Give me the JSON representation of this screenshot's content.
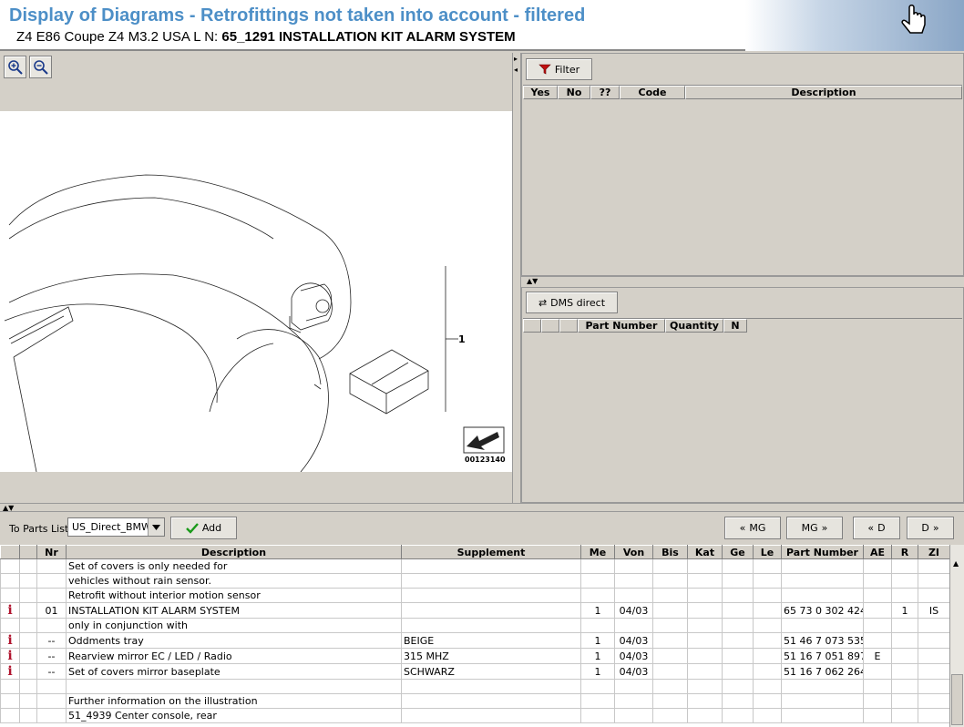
{
  "header": {
    "title": "Display of Diagrams - Retrofittings not taken into account - filtered",
    "vehicle": "Z4 E86 Coupe Z4 M3.2 USA  L N:",
    "group": "65_1291 INSTALLATION KIT ALARM SYSTEM"
  },
  "diagram": {
    "callout": "1",
    "image_number": "00123140"
  },
  "filter_panel": {
    "filter_label": "Filter",
    "columns": [
      "Yes",
      "No",
      "??",
      "Code",
      "Description"
    ]
  },
  "dms_panel": {
    "dms_label": "DMS direct",
    "columns": [
      "",
      "",
      "",
      "Part Number",
      "Quantity",
      "N"
    ]
  },
  "parts_bar": {
    "to_parts_label": "To Parts List",
    "list_value": "US_Direct_BMW",
    "add_label": "Add",
    "prev_mg": "MG",
    "next_mg": "MG",
    "prev_d": "D",
    "next_d": "D"
  },
  "parts_table": {
    "columns": [
      "",
      "",
      "Nr",
      "Description",
      "Supplement",
      "Me",
      "Von",
      "Bis",
      "Kat",
      "Ge",
      "Le",
      "Part Number",
      "AE",
      "R",
      "ZI"
    ],
    "rows": [
      {
        "info": "",
        "nr": "",
        "desc": "Set of covers is only needed for",
        "sup": "",
        "me": "",
        "von": "",
        "pn": "",
        "ae": "",
        "r": "",
        "zi": ""
      },
      {
        "info": "",
        "nr": "",
        "desc": "vehicles without rain sensor.",
        "sup": "",
        "me": "",
        "von": "",
        "pn": "",
        "ae": "",
        "r": "",
        "zi": ""
      },
      {
        "info": "",
        "nr": "",
        "desc": "Retrofit without interior motion sensor",
        "sup": "",
        "me": "",
        "von": "",
        "pn": "",
        "ae": "",
        "r": "",
        "zi": ""
      },
      {
        "info": "i",
        "nr": "01",
        "desc": "INSTALLATION KIT ALARM SYSTEM",
        "sup": "",
        "me": "1",
        "von": "04/03",
        "pn": "65 73 0 302 424",
        "ae": "",
        "r": "1",
        "zi": "IS"
      },
      {
        "info": "",
        "nr": "",
        "desc": "only in conjunction with",
        "sup": "",
        "me": "",
        "von": "",
        "pn": "",
        "ae": "",
        "r": "",
        "zi": ""
      },
      {
        "info": "i",
        "nr": "--",
        "desc": "Oddments tray",
        "sup": "BEIGE",
        "me": "1",
        "von": "04/03",
        "pn": "51 46 7 073 535",
        "ae": "",
        "r": "",
        "zi": ""
      },
      {
        "info": "i",
        "nr": "--",
        "desc": "Rearview mirror EC / LED / Radio",
        "sup": "315 MHZ",
        "me": "1",
        "von": "04/03",
        "pn": "51 16 7 051 897",
        "ae": "E",
        "r": "",
        "zi": ""
      },
      {
        "info": "i",
        "nr": "--",
        "desc": "Set of covers mirror baseplate",
        "sup": "SCHWARZ",
        "me": "1",
        "von": "04/03",
        "pn": "51 16 7 062 264",
        "ae": "",
        "r": "",
        "zi": ""
      },
      {
        "info": "",
        "nr": "",
        "desc": "",
        "sup": "",
        "me": "",
        "von": "",
        "pn": "",
        "ae": "",
        "r": "",
        "zi": ""
      },
      {
        "info": "",
        "nr": "",
        "desc": "Further information on the illustration",
        "sup": "",
        "me": "",
        "von": "",
        "pn": "",
        "ae": "",
        "r": "",
        "zi": ""
      },
      {
        "info": "",
        "nr": "",
        "desc": "51_4939 Center console, rear",
        "sup": "",
        "me": "",
        "von": "",
        "pn": "",
        "ae": "",
        "r": "",
        "zi": ""
      }
    ]
  },
  "colors": {
    "title_blue": "#4d8fc7",
    "info_red": "#b0142e",
    "panel_gray": "#d4d0c8"
  }
}
